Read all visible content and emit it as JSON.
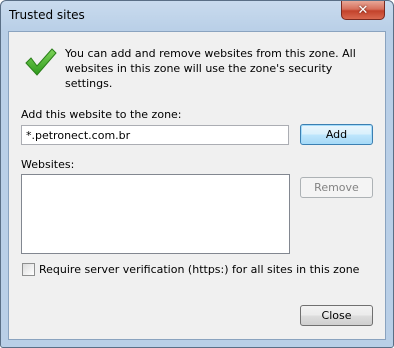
{
  "window": {
    "title": "Trusted sites",
    "close_glyph": "✕"
  },
  "info": {
    "text": "You can add and remove websites from this zone. All websites in this zone will use the zone's security settings.",
    "icon": "green-checkmark-icon"
  },
  "add_section": {
    "label": "Add this website to the zone:",
    "url_value": "*.petronect.com.br",
    "add_button": "Add"
  },
  "websites_section": {
    "label": "Websites:",
    "items": [],
    "remove_button": "Remove"
  },
  "https_check": {
    "label": "Require server verification (https:) for all sites in this zone",
    "checked": false
  },
  "footer": {
    "close_button": "Close"
  },
  "colors": {
    "accent_check": "#3fae2a",
    "window_frame": "#b9cfe7",
    "close_button": "#c3422b"
  }
}
